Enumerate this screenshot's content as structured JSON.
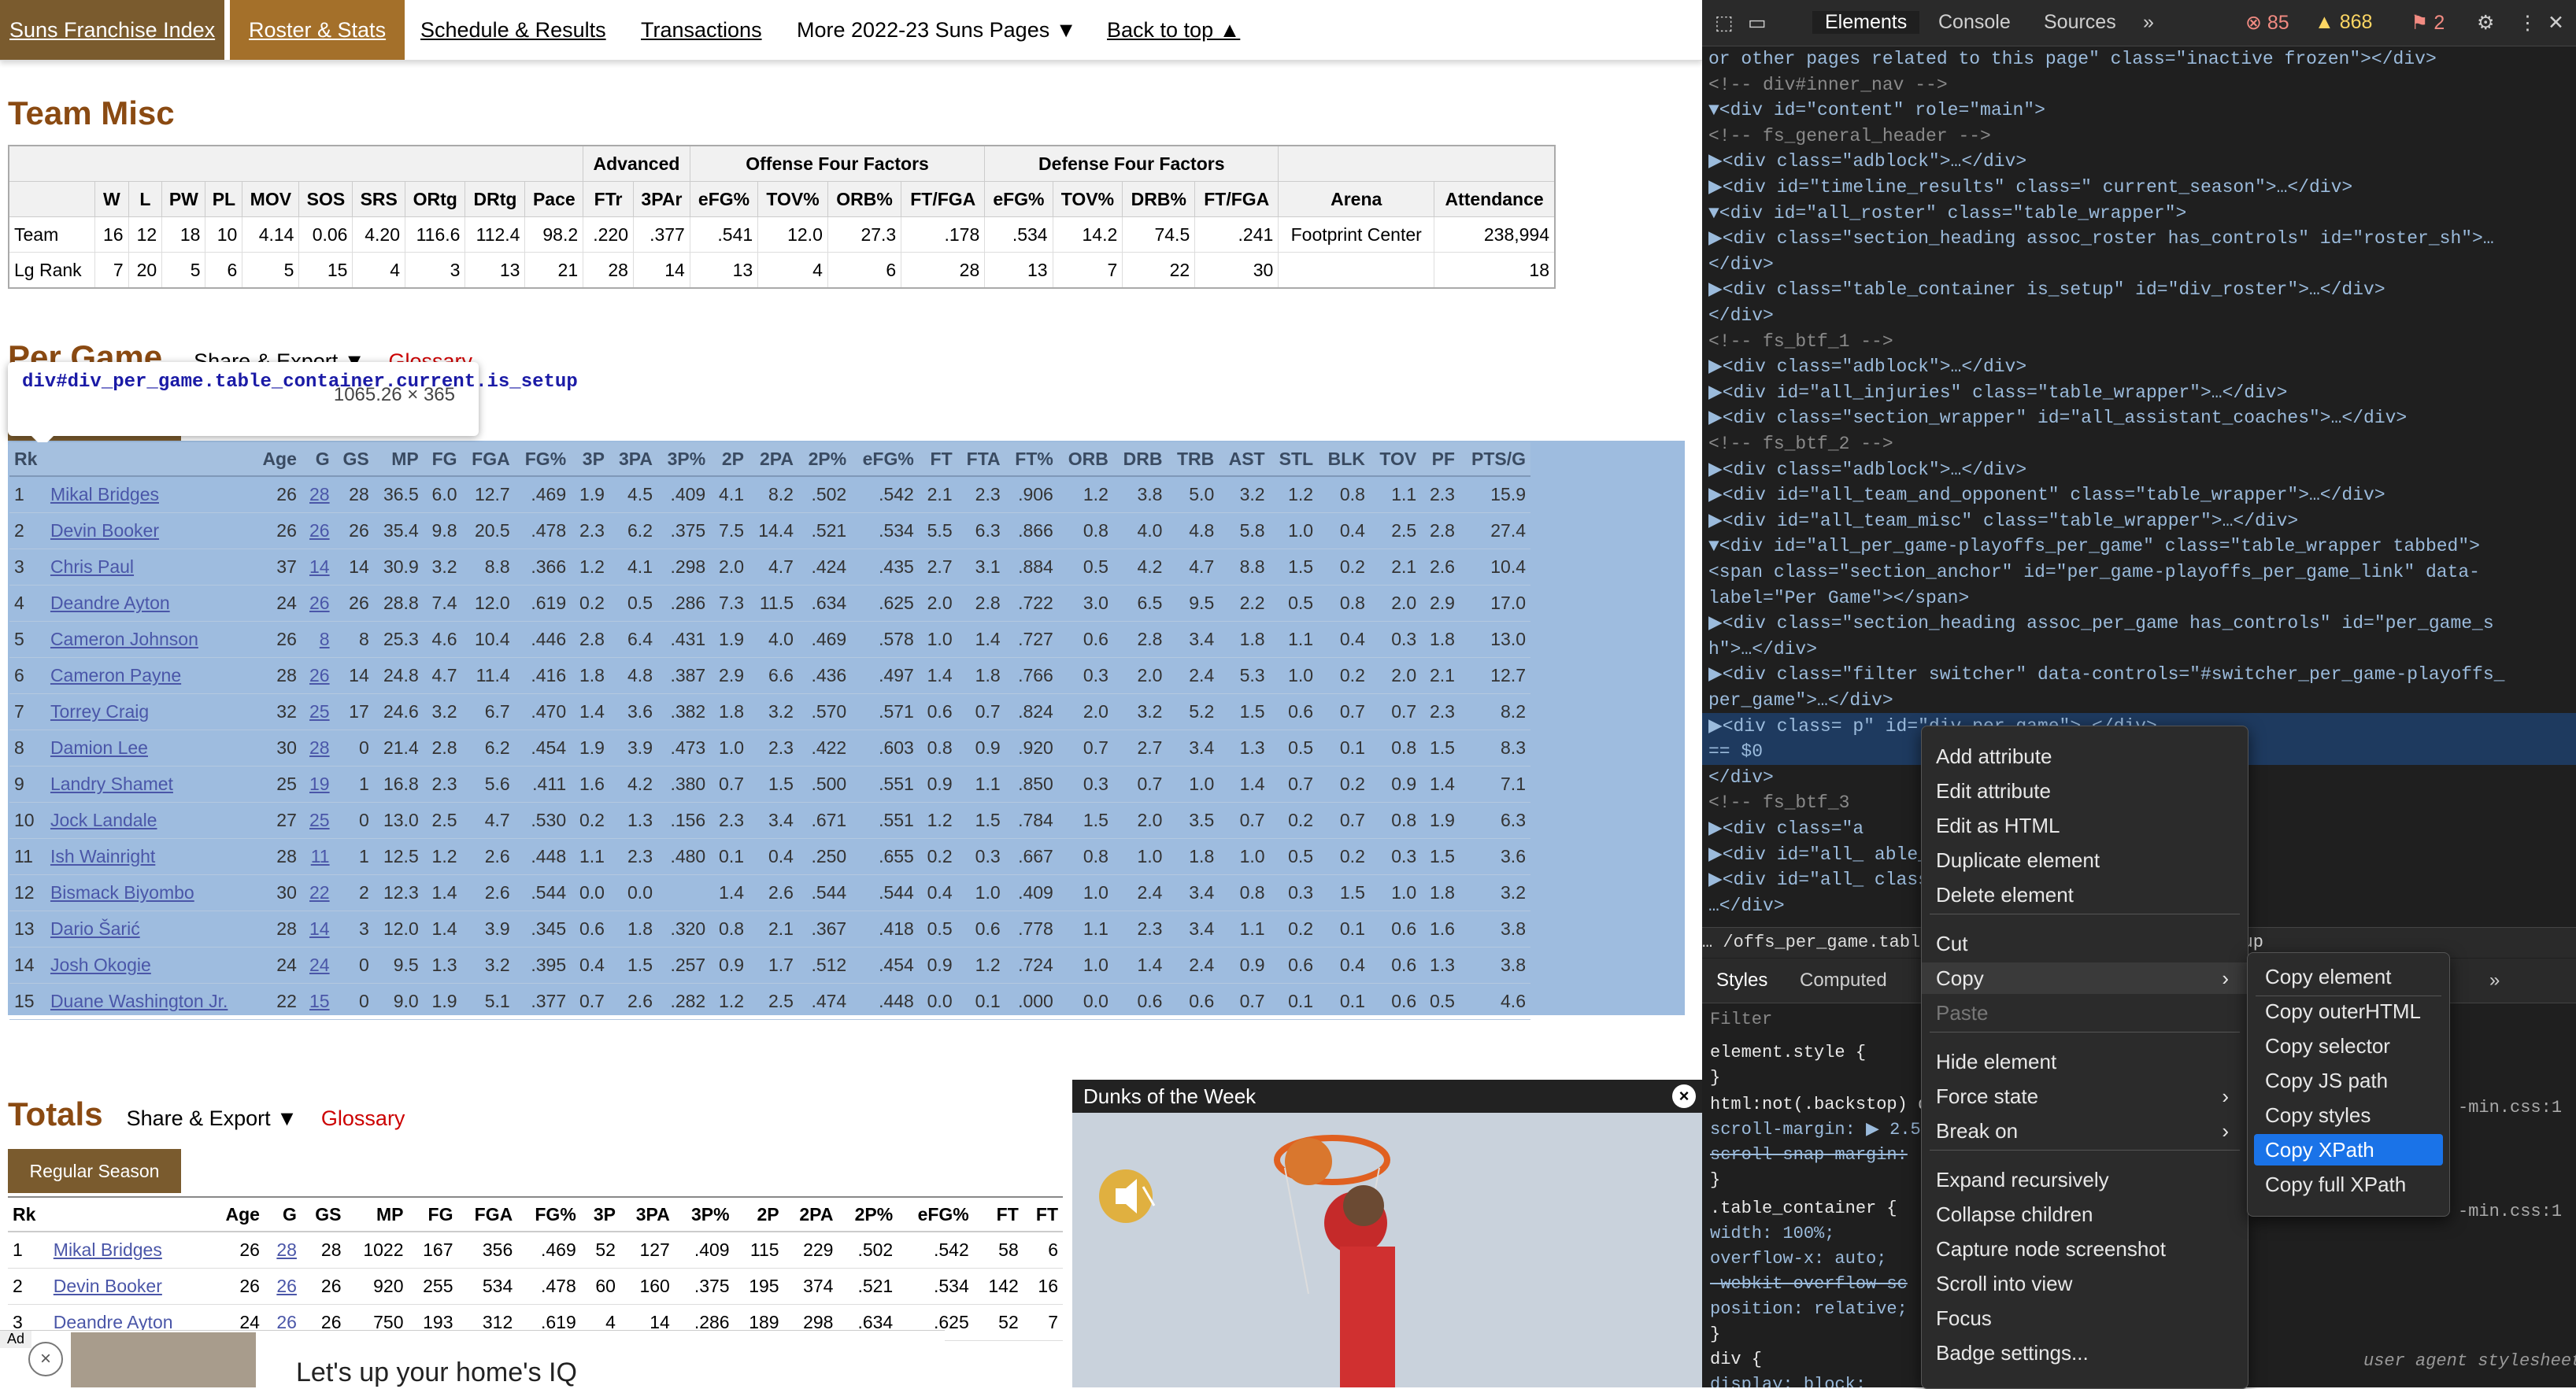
{
  "nav": {
    "items": [
      "Suns Franchise Index",
      "Roster & Stats",
      "Schedule & Results",
      "Transactions",
      "More 2022-23 Suns Pages ▼",
      "Back to top ▲"
    ]
  },
  "team_misc": {
    "title": "Team Misc",
    "group_headers": [
      "Advanced",
      "Offense Four Factors",
      "Defense Four Factors"
    ],
    "columns": [
      "",
      "W",
      "L",
      "PW",
      "PL",
      "MOV",
      "SOS",
      "SRS",
      "ORtg",
      "DRtg",
      "Pace",
      "FTr",
      "3PAr",
      "eFG%",
      "TOV%",
      "ORB%",
      "FT/FGA",
      "eFG%",
      "TOV%",
      "DRB%",
      "FT/FGA",
      "Arena",
      "Attendance"
    ],
    "rows": [
      [
        "Team",
        "16",
        "12",
        "18",
        "10",
        "4.14",
        "0.06",
        "4.20",
        "116.6",
        "112.4",
        "98.2",
        ".220",
        ".377",
        ".541",
        "12.0",
        "27.3",
        ".178",
        ".534",
        "14.2",
        "74.5",
        ".241",
        "Footprint Center",
        "238,994"
      ],
      [
        "Lg Rank",
        "7",
        "20",
        "5",
        "6",
        "5",
        "15",
        "4",
        "3",
        "13",
        "21",
        "28",
        "14",
        "13",
        "4",
        "6",
        "28",
        "13",
        "7",
        "22",
        "30",
        "",
        "18"
      ]
    ]
  },
  "per_game": {
    "title": "Per Game",
    "share_export": "Share & Export ▼",
    "glossary": "Glossary",
    "tooltip_selector": "div#div_per_game.table_container.current.is_setup",
    "tooltip_size": "1065.26 × 365",
    "columns": [
      "Rk",
      "",
      "Age",
      "G",
      "GS",
      "MP",
      "FG",
      "FGA",
      "FG%",
      "3P",
      "3PA",
      "3P%",
      "2P",
      "2PA",
      "2P%",
      "eFG%",
      "FT",
      "FTA",
      "FT%",
      "ORB",
      "DRB",
      "TRB",
      "AST",
      "STL",
      "BLK",
      "TOV",
      "PF",
      "PTS/G"
    ],
    "rows": [
      [
        "1",
        "Mikal Bridges",
        "26",
        "28",
        "28",
        "36.5",
        "6.0",
        "12.7",
        ".469",
        "1.9",
        "4.5",
        ".409",
        "4.1",
        "8.2",
        ".502",
        ".542",
        "2.1",
        "2.3",
        ".906",
        "1.2",
        "3.8",
        "5.0",
        "3.2",
        "1.2",
        "0.8",
        "1.1",
        "2.3",
        "15.9"
      ],
      [
        "2",
        "Devin Booker",
        "26",
        "26",
        "26",
        "35.4",
        "9.8",
        "20.5",
        ".478",
        "2.3",
        "6.2",
        ".375",
        "7.5",
        "14.4",
        ".521",
        ".534",
        "5.5",
        "6.3",
        ".866",
        "0.8",
        "4.0",
        "4.8",
        "5.8",
        "1.0",
        "0.4",
        "2.5",
        "2.8",
        "27.4"
      ],
      [
        "3",
        "Chris Paul",
        "37",
        "14",
        "14",
        "30.9",
        "3.2",
        "8.8",
        ".366",
        "1.2",
        "4.1",
        ".298",
        "2.0",
        "4.7",
        ".424",
        ".435",
        "2.7",
        "3.1",
        ".884",
        "0.5",
        "4.2",
        "4.7",
        "8.8",
        "1.5",
        "0.2",
        "2.1",
        "2.6",
        "10.4"
      ],
      [
        "4",
        "Deandre Ayton",
        "24",
        "26",
        "26",
        "28.8",
        "7.4",
        "12.0",
        ".619",
        "0.2",
        "0.5",
        ".286",
        "7.3",
        "11.5",
        ".634",
        ".625",
        "2.0",
        "2.8",
        ".722",
        "3.0",
        "6.5",
        "9.5",
        "2.2",
        "0.5",
        "0.8",
        "2.0",
        "2.9",
        "17.0"
      ],
      [
        "5",
        "Cameron Johnson",
        "26",
        "8",
        "8",
        "25.3",
        "4.6",
        "10.4",
        ".446",
        "2.8",
        "6.4",
        ".431",
        "1.9",
        "4.0",
        ".469",
        ".578",
        "1.0",
        "1.4",
        ".727",
        "0.6",
        "2.8",
        "3.4",
        "1.8",
        "1.1",
        "0.4",
        "0.3",
        "1.8",
        "13.0"
      ],
      [
        "6",
        "Cameron Payne",
        "28",
        "26",
        "14",
        "24.8",
        "4.7",
        "11.4",
        ".416",
        "1.8",
        "4.8",
        ".387",
        "2.9",
        "6.6",
        ".436",
        ".497",
        "1.4",
        "1.8",
        ".766",
        "0.3",
        "2.0",
        "2.4",
        "5.3",
        "1.0",
        "0.2",
        "2.0",
        "2.1",
        "12.7"
      ],
      [
        "7",
        "Torrey Craig",
        "32",
        "25",
        "17",
        "24.6",
        "3.2",
        "6.7",
        ".470",
        "1.4",
        "3.6",
        ".382",
        "1.8",
        "3.2",
        ".570",
        ".571",
        "0.6",
        "0.7",
        ".824",
        "2.0",
        "3.2",
        "5.2",
        "1.5",
        "0.6",
        "0.7",
        "0.7",
        "2.3",
        "8.2"
      ],
      [
        "8",
        "Damion Lee",
        "30",
        "28",
        "0",
        "21.4",
        "2.8",
        "6.2",
        ".454",
        "1.9",
        "3.9",
        ".473",
        "1.0",
        "2.3",
        ".422",
        ".603",
        "0.8",
        "0.9",
        ".920",
        "0.7",
        "2.7",
        "3.4",
        "1.3",
        "0.5",
        "0.1",
        "0.8",
        "1.5",
        "8.3"
      ],
      [
        "9",
        "Landry Shamet",
        "25",
        "19",
        "1",
        "16.8",
        "2.3",
        "5.6",
        ".411",
        "1.6",
        "4.2",
        ".380",
        "0.7",
        "1.5",
        ".500",
        ".551",
        "0.9",
        "1.1",
        ".850",
        "0.3",
        "0.7",
        "1.0",
        "1.4",
        "0.7",
        "0.2",
        "0.9",
        "1.4",
        "7.1"
      ],
      [
        "10",
        "Jock Landale",
        "27",
        "25",
        "0",
        "13.0",
        "2.5",
        "4.7",
        ".530",
        "0.2",
        "1.3",
        ".156",
        "2.3",
        "3.4",
        ".671",
        ".551",
        "1.2",
        "1.5",
        ".784",
        "1.5",
        "2.0",
        "3.5",
        "0.7",
        "0.2",
        "0.7",
        "0.8",
        "1.9",
        "6.3"
      ],
      [
        "11",
        "Ish Wainright",
        "28",
        "11",
        "1",
        "12.5",
        "1.2",
        "2.6",
        ".448",
        "1.1",
        "2.3",
        ".480",
        "0.1",
        "0.4",
        ".250",
        ".655",
        "0.2",
        "0.3",
        ".667",
        "0.8",
        "1.0",
        "1.8",
        "1.0",
        "0.5",
        "0.2",
        "0.3",
        "1.5",
        "3.6"
      ],
      [
        "12",
        "Bismack Biyombo",
        "30",
        "22",
        "2",
        "12.3",
        "1.4",
        "2.6",
        ".544",
        "0.0",
        "0.0",
        "",
        "1.4",
        "2.6",
        ".544",
        ".544",
        "0.4",
        "1.0",
        ".409",
        "1.0",
        "2.4",
        "3.4",
        "0.8",
        "0.3",
        "1.5",
        "1.0",
        "1.8",
        "3.2"
      ],
      [
        "13",
        "Dario Šarić",
        "28",
        "14",
        "3",
        "12.0",
        "1.4",
        "3.9",
        ".345",
        "0.6",
        "1.8",
        ".320",
        "0.8",
        "2.1",
        ".367",
        ".418",
        "0.5",
        "0.6",
        ".778",
        "1.1",
        "2.3",
        "3.4",
        "1.1",
        "0.2",
        "0.1",
        "0.6",
        "1.6",
        "3.8"
      ],
      [
        "14",
        "Josh Okogie",
        "24",
        "24",
        "0",
        "9.5",
        "1.3",
        "3.2",
        ".395",
        "0.4",
        "1.5",
        ".257",
        "0.9",
        "1.7",
        ".512",
        ".454",
        "0.9",
        "1.2",
        ".724",
        "1.0",
        "1.4",
        "2.4",
        "0.9",
        "0.6",
        "0.4",
        "0.6",
        "1.3",
        "3.8"
      ],
      [
        "15",
        "Duane Washington Jr.",
        "22",
        "15",
        "0",
        "9.0",
        "1.9",
        "5.1",
        ".377",
        "0.7",
        "2.6",
        ".282",
        "1.2",
        "2.5",
        ".474",
        ".448",
        "0.0",
        "0.1",
        ".000",
        "0.0",
        "0.6",
        "0.6",
        "0.7",
        "0.1",
        "0.1",
        "0.6",
        "0.5",
        "4.6"
      ]
    ]
  },
  "totals": {
    "title": "Totals",
    "share_export": "Share & Export ▼",
    "glossary": "Glossary",
    "tab": "Regular Season",
    "columns": [
      "Rk",
      "",
      "Age",
      "G",
      "GS",
      "MP",
      "FG",
      "FGA",
      "FG%",
      "3P",
      "3PA",
      "3P%",
      "2P",
      "2PA",
      "2P%",
      "eFG%",
      "FT",
      "FT"
    ],
    "rows": [
      [
        "1",
        "Mikal Bridges",
        "26",
        "28",
        "28",
        "1022",
        "167",
        "356",
        ".469",
        "52",
        "127",
        ".409",
        "115",
        "229",
        ".502",
        ".542",
        "58",
        "6"
      ],
      [
        "2",
        "Devin Booker",
        "26",
        "26",
        "26",
        "920",
        "255",
        "534",
        ".478",
        "60",
        "160",
        ".375",
        "195",
        "374",
        ".521",
        ".534",
        "142",
        "16"
      ],
      [
        "3",
        "Deandre Ayton",
        "24",
        "26",
        "26",
        "750",
        "193",
        "312",
        ".619",
        "4",
        "14",
        ".286",
        "189",
        "298",
        ".634",
        ".625",
        "52",
        "7"
      ]
    ]
  },
  "video": {
    "title": "Dunks of the Week",
    "close": "×"
  },
  "ad": {
    "label": "Ad",
    "close": "×",
    "text": "Let's up your home's IQ"
  },
  "devtools": {
    "tabs": [
      "Elements",
      "Console",
      "Sources",
      "»"
    ],
    "errors": "85",
    "warnings": "868",
    "issues": "2",
    "dom_lines": [
      "  or other pages related to this page\" class=\"inactive frozen\"></div>",
      "  <!-- div#inner_nav -->",
      "▼<div id=\"content\" role=\"main\">",
      "   <!-- fs_general_header -->",
      "  ▶<div class=\"adblock\">…</div>",
      "  ▶<div id=\"timeline_results\" class=\" current_season\">…</div>",
      "  ▼<div id=\"all_roster\" class=\"table_wrapper\">",
      "    ▶<div class=\"section_heading assoc_roster has_controls\" id=\"roster_sh\">…",
      "     </div>",
      "    ▶<div class=\"table_container is_setup\" id=\"div_roster\">…</div>",
      "   </div>",
      "   <!-- fs_btf_1 -->",
      "  ▶<div class=\"adblock\">…</div>",
      "  ▶<div id=\"all_injuries\" class=\"table_wrapper\">…</div>",
      "  ▶<div class=\"section_wrapper\" id=\"all_assistant_coaches\">…</div>",
      "   <!-- fs_btf_2 -->",
      "  ▶<div class=\"adblock\">…</div>",
      "  ▶<div id=\"all_team_and_opponent\" class=\"table_wrapper\">…</div>",
      "  ▶<div id=\"all_team_misc\" class=\"table_wrapper\">…</div>",
      "  ▼<div id=\"all_per_game-playoffs_per_game\" class=\"table_wrapper tabbed\">",
      "     <span class=\"section_anchor\" id=\"per_game-playoffs_per_game_link\" data-",
      "     label=\"Per Game\"></span>",
      "    ▶<div class=\"section_heading assoc_per_game has_controls\" id=\"per_game_s",
      "     h\">…</div>",
      "    ▶<div class=\"filter switcher\" data-controls=\"#switcher_per_game-playoffs_",
      "     per_game\">…</div>",
      "    ▶<div class=                                 p\" id=\"div_per_game\">…</div>",
      "     == $0",
      "   </div>",
      "   <!-- fs_btf_3",
      "  ▶<div class=\"a",
      "  ▶<div id=\"all_                                able_wrapper tabbed\">…</div>",
      "  ▶<div id=\"all_                                class=\"table_wrapper tabbed\">",
      "   …</div>"
    ],
    "breadcrumb": "…  /offs_per_game.table_                                 ole_container.current.is_setup",
    "styles_tabs": [
      "Styles",
      "Computed",
      "L",
      "»"
    ],
    "filter_placeholder": "Filter",
    "style_lines": [
      "element.style {",
      "}",
      "html:not(.backstop) di",
      "  scroll-margin: ▶ 2.5",
      "  scroll-snap-margin:",
      "}",
      ".table_container {",
      "  width: 100%;",
      "  overflow-x: auto;",
      "  -webkit-overflow-sc",
      "  position: relative;",
      "}",
      "div {",
      "  display: block;"
    ],
    "style_sources": [
      "-min.css:1",
      "-min.css:1"
    ],
    "ua_label": "user agent stylesheet"
  },
  "context_menu": {
    "items": [
      {
        "label": "Add attribute"
      },
      {
        "label": "Edit attribute"
      },
      {
        "label": "Edit as HTML"
      },
      {
        "label": "Duplicate element"
      },
      {
        "label": "Delete element"
      },
      {
        "label": "Cut"
      },
      {
        "label": "Copy",
        "arrow": "›"
      },
      {
        "label": "Paste"
      },
      {
        "label": "Hide element"
      },
      {
        "label": "Force state",
        "arrow": "›"
      },
      {
        "label": "Break on",
        "arrow": "›"
      },
      {
        "label": "Expand recursively"
      },
      {
        "label": "Collapse children"
      },
      {
        "label": "Capture node screenshot"
      },
      {
        "label": "Scroll into view"
      },
      {
        "label": "Focus"
      },
      {
        "label": "Badge settings..."
      }
    ],
    "copy_submenu": [
      "Copy element",
      "Copy outerHTML",
      "Copy selector",
      "Copy JS path",
      "Copy styles",
      "Copy XPath",
      "Copy full XPath"
    ],
    "highlighted": "Copy XPath"
  }
}
